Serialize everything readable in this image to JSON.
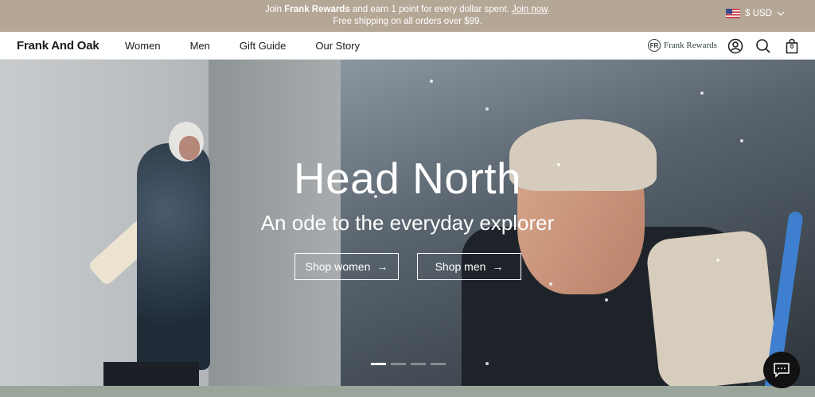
{
  "announcement": {
    "pre": "Join ",
    "brand": "Frank Rewards",
    "mid": " and earn 1 point for every dollar spent. ",
    "link": "Join now",
    "end": ".",
    "shipping": "Free shipping on all orders over $99."
  },
  "currency": {
    "label": "$ USD"
  },
  "nav": {
    "brand": "Frank And Oak",
    "links": [
      "Women",
      "Men",
      "Gift Guide",
      "Our Story"
    ],
    "rewards": {
      "badge": "FR",
      "label": "Frank Rewards"
    },
    "bag_count": "0"
  },
  "hero": {
    "title": "Head North",
    "subtitle": "An ode to the everyday explorer",
    "cta_women": "Shop women",
    "cta_men": "Shop men",
    "arrow": "→",
    "slides": 4,
    "active_slide": 1
  },
  "icons": [
    "us-flag-icon",
    "chevron-down-icon",
    "account-icon",
    "search-icon",
    "bag-icon",
    "chat-icon"
  ],
  "colors": {
    "announce_bg": "#b4a796",
    "strip": "#9aa59c",
    "chat_bg": "#111111"
  }
}
